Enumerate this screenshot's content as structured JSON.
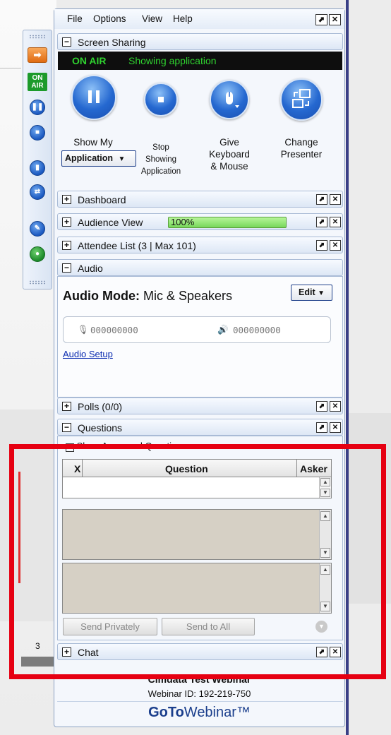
{
  "menu": {
    "items": [
      "File",
      "Options",
      "View",
      "Help"
    ]
  },
  "toolbar": {
    "onair_label": "ON AIR"
  },
  "screen_sharing": {
    "title": "Screen Sharing",
    "status_on": "ON AIR",
    "status_text": "Showing application",
    "show_my": "Show My",
    "application_select": "Application",
    "stop_line1": "Stop",
    "stop_line2": "Showing",
    "stop_line3": "Application",
    "give_line1": "Give",
    "give_line2": "Keyboard",
    "give_line3": "& Mouse",
    "change_line1": "Change",
    "change_line2": "Presenter"
  },
  "dashboard": {
    "title": "Dashboard"
  },
  "audience_view": {
    "title": "Audience View",
    "percent_label": "100%",
    "percent": 100
  },
  "attendee_list": {
    "title": "Attendee List  (3 | Max 101)"
  },
  "audio": {
    "title": "Audio",
    "mode_label": "Audio Mode:",
    "mode_value": "Mic & Speakers",
    "edit_label": "Edit",
    "mic_level": "000000000",
    "speaker_level": "000000000",
    "setup_link": "Audio Setup"
  },
  "polls": {
    "title": "Polls (0/0)"
  },
  "questions": {
    "title": "Questions",
    "show_answered": "Show Answered Questions",
    "col_x": "X",
    "col_question": "Question",
    "col_asker": "Asker",
    "send_privately": "Send Privately",
    "send_to_all": "Send to All"
  },
  "chat": {
    "title": "Chat"
  },
  "footer": {
    "webinar_title": "Cimdata Test Webinar",
    "webinar_id": "Webinar ID: 192-219-750",
    "logo_goto": "GoTo",
    "logo_webinar": "Webinar™"
  },
  "background": {
    "page_number": "3"
  },
  "colors": {
    "onair_green": "#2fd12f",
    "brand_blue": "#1a3e8c",
    "highlight_red": "#e60012"
  }
}
